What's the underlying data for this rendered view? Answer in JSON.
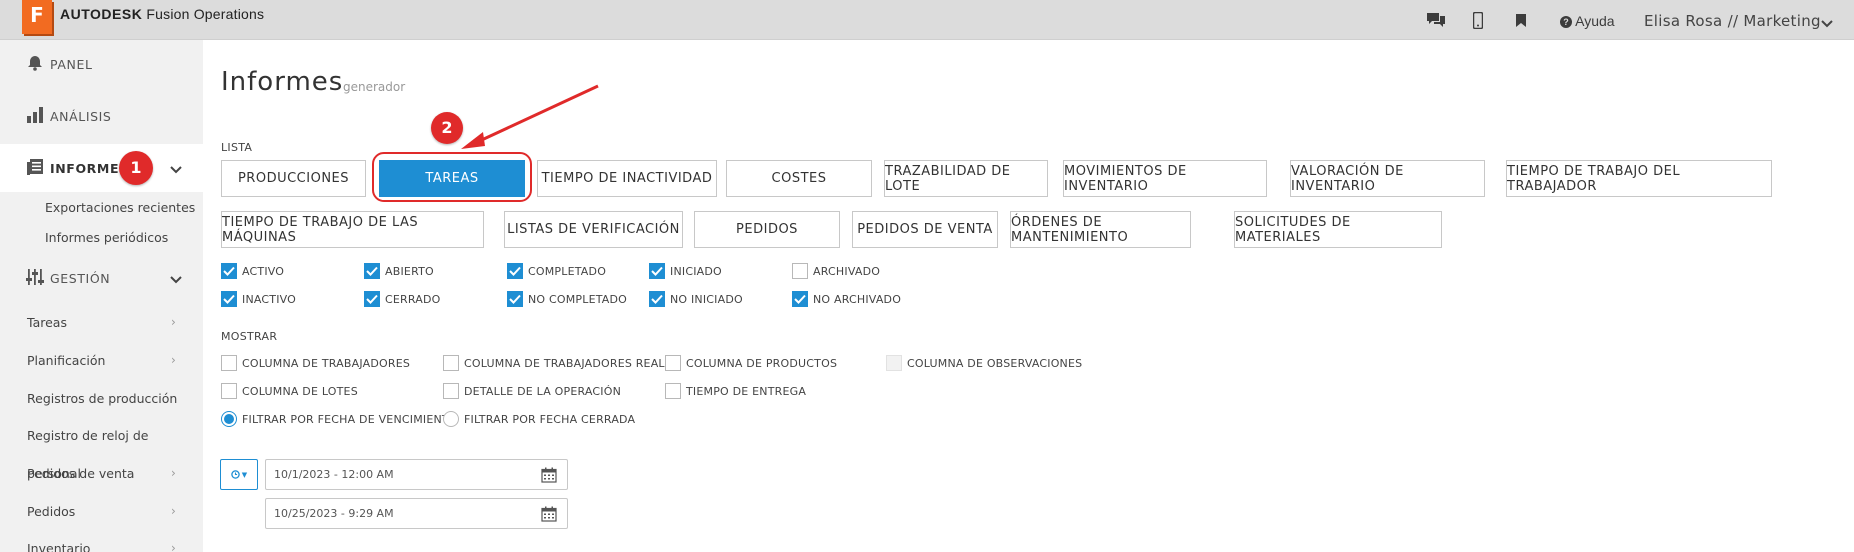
{
  "header": {
    "brand_bold": "AUTODESK",
    "brand_rest": " Fusion Operations",
    "logo_letter": "F",
    "help_label": "Ayuda",
    "user_label": "Elisa Rosa // Marketing"
  },
  "sidebar": {
    "items": [
      {
        "label": "PANEL",
        "icon": "bell-icon"
      },
      {
        "label": "ANÁLISIS",
        "icon": "bar-chart-icon"
      },
      {
        "label": "INFORMES",
        "icon": "report-icon"
      },
      {
        "label": "GESTIÓN",
        "icon": "sliders-icon"
      }
    ],
    "sub_items": [
      "Exportaciones recientes",
      "Informes periódicos"
    ],
    "links": [
      "Tareas",
      "Planificación",
      "Registros de producción",
      "Registro de reloj de",
      "Pedidos de venta",
      "Pedidos",
      "Inventario"
    ],
    "overlap_text": "personal"
  },
  "annotations": {
    "badge1": "1",
    "badge2": "2"
  },
  "main": {
    "title": "Informes",
    "subtitle": "generador",
    "list_label": "LISTA",
    "buttons_row1": [
      "PRODUCCIONES",
      "TAREAS",
      "TIEMPO DE INACTIVIDAD",
      "COSTES",
      "TRAZABILIDAD DE LOTE",
      "MOVIMIENTOS DE INVENTARIO",
      "VALORACIÓN DE INVENTARIO",
      "TIEMPO DE TRABAJO DEL TRABAJADOR"
    ],
    "buttons_row2": [
      "TIEMPO DE TRABAJO DE LAS MÁQUINAS",
      "LISTAS DE VERIFICACIÓN",
      "PEDIDOS",
      "PEDIDOS DE VENTA",
      "ÓRDENES DE MANTENIMIENTO",
      "SOLICITUDES DE MATERIALES"
    ],
    "active_button": "TAREAS",
    "filters": [
      {
        "label": "ACTIVO",
        "checked": true
      },
      {
        "label": "ABIERTO",
        "checked": true
      },
      {
        "label": "COMPLETADO",
        "checked": true
      },
      {
        "label": "INICIADO",
        "checked": true
      },
      {
        "label": "ARCHIVADO",
        "checked": false
      },
      {
        "label": "INACTIVO",
        "checked": true
      },
      {
        "label": "CERRADO",
        "checked": true
      },
      {
        "label": "NO COMPLETADO",
        "checked": true
      },
      {
        "label": "NO INICIADO",
        "checked": true
      },
      {
        "label": "NO ARCHIVADO",
        "checked": true
      }
    ],
    "show_label": "MOSTRAR",
    "show_options": [
      {
        "label": "COLUMNA DE TRABAJADORES",
        "checked": false
      },
      {
        "label": "COLUMNA DE TRABAJADORES REALES",
        "checked": false
      },
      {
        "label": "COLUMNA DE PRODUCTOS",
        "checked": false
      },
      {
        "label": "COLUMNA DE OBSERVACIONES",
        "checked": false,
        "disabled": true
      },
      {
        "label": "COLUMNA DE LOTES",
        "checked": false
      },
      {
        "label": "DETALLE DE LA OPERACIÓN",
        "checked": false
      },
      {
        "label": "TIEMPO DE ENTREGA",
        "checked": false
      }
    ],
    "radio_options": [
      {
        "label": "FILTRAR POR FECHA DE VENCIMIENTO",
        "checked": true
      },
      {
        "label": "FILTRAR POR FECHA CERRADA",
        "checked": false
      }
    ],
    "date_from": "10/1/2023 - 12:00 AM",
    "date_to": "10/25/2023 - 9:29 AM"
  },
  "colors": {
    "accent": "#1e8ed3",
    "annotation": "#e02a2a",
    "brand": "#f26b21"
  }
}
